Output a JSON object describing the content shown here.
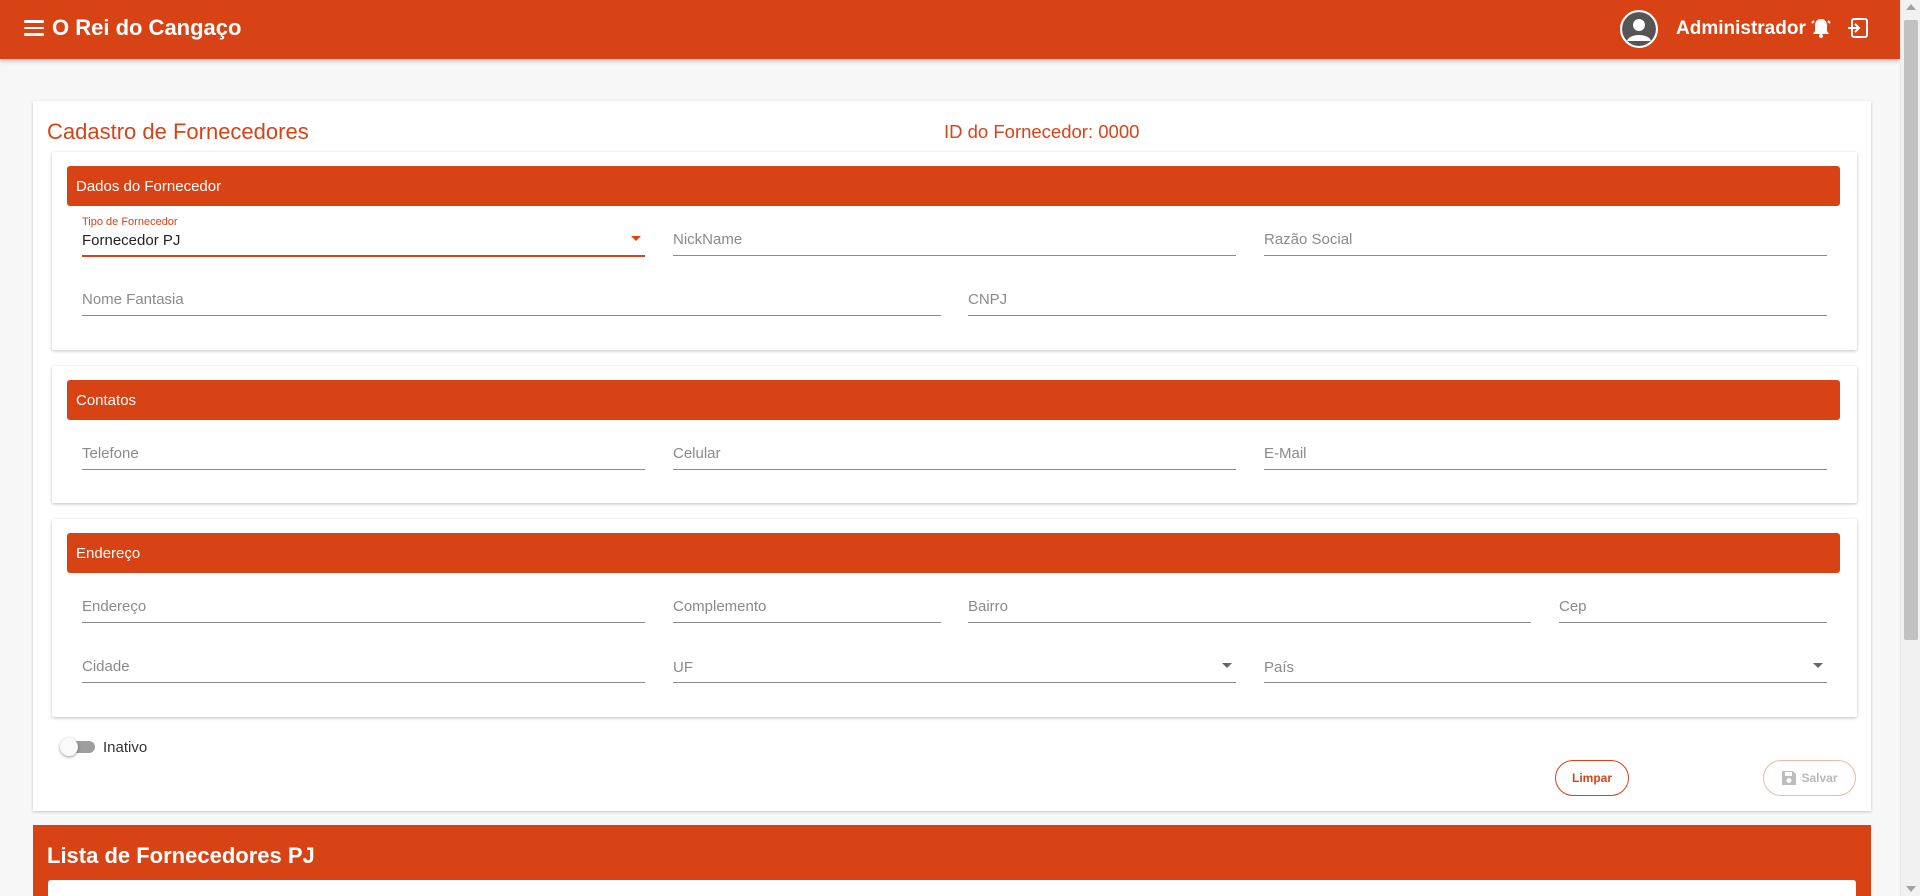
{
  "app": {
    "title": "O Rei do Cangaço",
    "user": "Administrador"
  },
  "form": {
    "title": "Cadastro de Fornecedores",
    "supplier_id": "ID do Fornecedor: 0000"
  },
  "sections": {
    "dados": {
      "header": "Dados do Fornecedor",
      "tipo_label": "Tipo de Fornecedor",
      "tipo_value": "Fornecedor PJ",
      "nickname_placeholder": "NickName",
      "razao_placeholder": "Razão Social",
      "fantasia_placeholder": "Nome Fantasia",
      "cnpj_placeholder": "CNPJ"
    },
    "contatos": {
      "header": "Contatos",
      "telefone_placeholder": "Telefone",
      "celular_placeholder": "Celular",
      "email_placeholder": "E-Mail"
    },
    "endereco": {
      "header": "Endereço",
      "endereco_placeholder": "Endereço",
      "complemento_placeholder": "Complemento",
      "bairro_placeholder": "Bairro",
      "cep_placeholder": "Cep",
      "cidade_placeholder": "Cidade",
      "uf_placeholder": "UF",
      "pais_placeholder": "País"
    }
  },
  "status": {
    "toggle_label": "Inativo",
    "active": false
  },
  "actions": {
    "clear_label": "Limpar",
    "save_label": "Salvar"
  },
  "list": {
    "title": "Lista de Fornecedores PJ"
  },
  "colors": {
    "accent": "#d84315",
    "background": "#f7f7f7"
  },
  "icons": [
    "menu-icon",
    "avatar-icon",
    "bell-icon",
    "logout-icon",
    "dropdown-caret-icon",
    "save-icon"
  ]
}
